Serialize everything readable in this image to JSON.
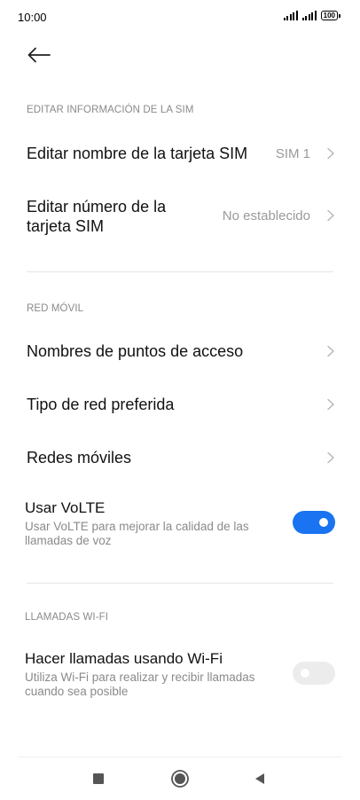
{
  "status_bar": {
    "time": "10:00",
    "battery": "100"
  },
  "sim_info": {
    "header": "EDITAR INFORMACIÓN DE LA SIM",
    "edit_name": {
      "label": "Editar nombre de la tarjeta SIM",
      "value": "SIM 1"
    },
    "edit_number": {
      "label_line1": "Editar número de la",
      "label_line2": "tarjeta SIM",
      "value": "No establecido"
    }
  },
  "mobile_network": {
    "header": "RED MÓVIL",
    "apn": "Nombres de puntos de acceso",
    "preferred_network": "Tipo de red preferida",
    "mobile_networks": "Redes móviles",
    "volte": {
      "title": "Usar VoLTE",
      "description": "Usar VoLTE para mejorar la calidad de las llamadas de voz",
      "enabled": true
    }
  },
  "wifi_calls": {
    "header": "LLAMADAS WI-FI",
    "title": "Hacer llamadas usando Wi-Fi",
    "description": "Utiliza Wi-Fi para realizar y recibir llamadas cuando sea posible",
    "enabled": false
  },
  "colors": {
    "accent": "#1a73f0",
    "secondary_text": "#8a8a8a",
    "toggle_off": "#ececec"
  },
  "icons": {
    "back": "arrow-left-icon",
    "chevron": "chevron-right-icon",
    "nav_recents": "square-icon",
    "nav_home": "circle-icon",
    "nav_back": "triangle-left-icon"
  }
}
